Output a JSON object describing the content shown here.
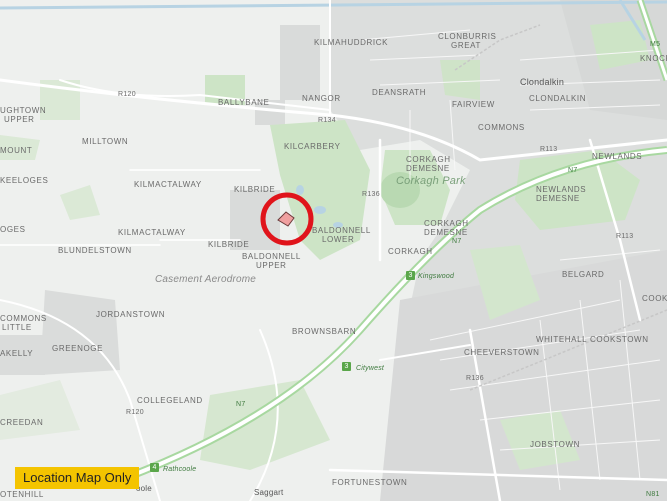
{
  "badge": {
    "text": "Location Map Only"
  },
  "places": {
    "kilmahuddrick": "KILMAHUDDRICK",
    "clonburris_great_1": "CLONBURRIS",
    "clonburris_great_2": "GREAT",
    "m5": "M5",
    "knock": "KNOCK",
    "ballybane": "BALLYBANE",
    "nangor": "NANGOR",
    "deansrath": "DEANSRATH",
    "clondalkin_town": "Clondalkin",
    "clondalkin": "CLONDALKIN",
    "fairview": "FAIRVIEW",
    "oughtown_upper_1": "UGHTOWN",
    "oughtown_upper_2": "UPPER",
    "milltown": "MILLTOWN",
    "r120_a": "R120",
    "r134": "R134",
    "commons": "COMMONS",
    "mount": "MOUNT",
    "kilcarbery": "KILCARBERY",
    "corkagh_demesne_1": "CORKAGH",
    "corkagh_demesne_2": "DEMESNE",
    "corkagh_park": "Corkagh Park",
    "r113_a": "R113",
    "newlands": "NEWLANDS",
    "n7_a": "N7",
    "keeloges": "KEELOGES",
    "kilmactalway_1": "KILMACTALWAY",
    "kilbride_1": "KILBRIDE",
    "r136": "R136",
    "newlands_demesne_1": "NEWLANDS",
    "newlands_demesne_2": "DEMESNE",
    "oges": "OGES",
    "kilmactalway_2": "KILMACTALWAY",
    "baldonnell_lower_1": "BALDONNELL",
    "baldonnell_lower_2": "LOWER",
    "corkagh_demesne2_1": "CORKAGH",
    "corkagh_demesne2_2": "DEMESNE",
    "n7_b": "N7",
    "r113_b": "R113",
    "blundelstown": "BLUNDELSTOWN",
    "kilbride_2": "KILBRIDE",
    "corkagh": "CORKAGH",
    "baldonnell_upper_1": "BALDONNELL",
    "baldonnell_upper_2": "UPPER",
    "kingswood": "Kingswood",
    "belgard": "BELGARD",
    "casement": "Casement Aerodrome",
    "cook": "COOK",
    "jordanstown": "JORDANSTOWN",
    "commons_little_1": "COMMONS",
    "commons_little_2": "LITTLE",
    "brownsbarn": "BROWNSBARN",
    "whitehall": "WHITEHALL",
    "cookstown": "COOKSTOWN",
    "greenoge": "GREENOGE",
    "akelly": "AKELLY",
    "cheeverstown": "CHEEVERSTOWN",
    "citywest": "Citywest",
    "r136_b": "R136",
    "collegeland": "COLLEGELAND",
    "r120_b": "R120",
    "n7_c": "N7",
    "creedan": "CREEDAN",
    "jobstown": "JOBSTOWN",
    "fortunestown": "FORTUNESTOWN",
    "rathcoole": "Rathcoole",
    "oole": "oole",
    "saggart": "Saggart",
    "otenhill": "OTENHILL",
    "n81": "N81"
  },
  "shields": {
    "kingswood": "3",
    "citywest": "3",
    "rathcoole": "4"
  },
  "colors": {
    "marker_ring": "#e0141b",
    "marker_fill": "#f0a0a0",
    "badge_bg": "#f4c400",
    "park": "#cde4c6",
    "road": "#ffffff",
    "motorway_casing": "#a8d8a0"
  }
}
